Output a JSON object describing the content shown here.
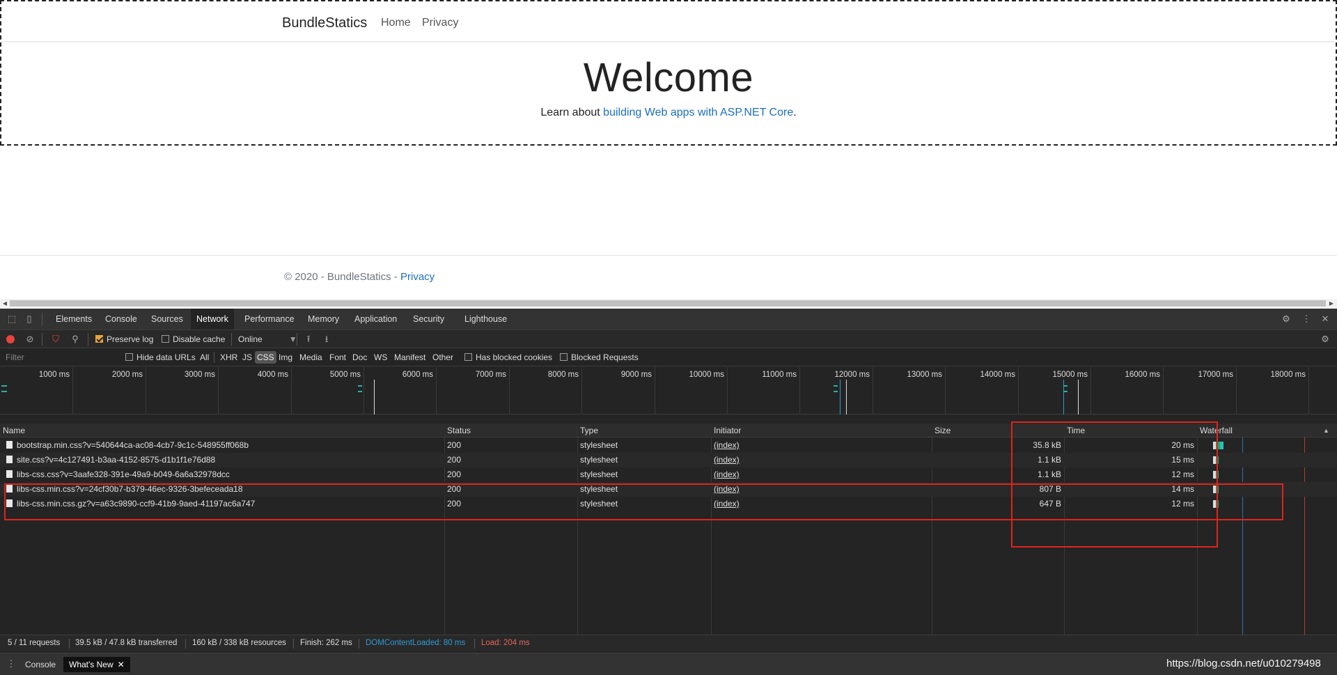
{
  "site": {
    "brand": "BundleStatics",
    "nav": [
      "Home",
      "Privacy"
    ],
    "hero_title": "Welcome",
    "hero_text": "Learn about ",
    "hero_link": "building Web apps with ASP.NET Core",
    "hero_end": ".",
    "footer_text": "© 2020 - BundleStatics - ",
    "footer_link": "Privacy"
  },
  "devtools": {
    "tabs": [
      "Elements",
      "Console",
      "Sources",
      "Network",
      "Performance",
      "Memory",
      "Application",
      "Security",
      "Lighthouse"
    ],
    "active_tab": "Network",
    "toolbar": {
      "preserve_log": "Preserve log",
      "disable_cache": "Disable cache",
      "throttle": "Online"
    },
    "filter": {
      "placeholder": "Filter",
      "hide_data_urls": "Hide data URLs",
      "types": [
        "All",
        "XHR",
        "JS",
        "CSS",
        "Img",
        "Media",
        "Font",
        "Doc",
        "WS",
        "Manifest",
        "Other"
      ],
      "active_type": "CSS",
      "blocked_cookies": "Has blocked cookies",
      "blocked_requests": "Blocked Requests"
    },
    "overview_ticks": [
      "1000 ms",
      "2000 ms",
      "3000 ms",
      "4000 ms",
      "5000 ms",
      "6000 ms",
      "7000 ms",
      "8000 ms",
      "9000 ms",
      "10000 ms",
      "11000 ms",
      "12000 ms",
      "13000 ms",
      "14000 ms",
      "15000 ms",
      "16000 ms",
      "17000 ms",
      "18000 ms"
    ],
    "columns": [
      "Name",
      "Status",
      "Type",
      "Initiator",
      "Size",
      "Time",
      "Waterfall"
    ],
    "requests": [
      {
        "name": "bootstrap.min.css?v=540644ca-ac08-4cb7-9c1c-548955ff068b",
        "status": "200",
        "type": "stylesheet",
        "initiator": "(index)",
        "size": "35.8 kB",
        "time": "20 ms"
      },
      {
        "name": "site.css?v=4c127491-b3aa-4152-8575-d1b1f1e76d88",
        "status": "200",
        "type": "stylesheet",
        "initiator": "(index)",
        "size": "1.1 kB",
        "time": "15 ms"
      },
      {
        "name": "libs-css.css?v=3aafe328-391e-49a9-b049-6a6a32978dcc",
        "status": "200",
        "type": "stylesheet",
        "initiator": "(index)",
        "size": "1.1 kB",
        "time": "12 ms"
      },
      {
        "name": "libs-css.min.css?v=24cf30b7-b379-46ec-9326-3befeceada18",
        "status": "200",
        "type": "stylesheet",
        "initiator": "(index)",
        "size": "807 B",
        "time": "14 ms"
      },
      {
        "name": "libs-css.min.css.gz?v=a63c9890-ccf9-41b9-9aed-41197ac6a747",
        "status": "200",
        "type": "stylesheet",
        "initiator": "(index)",
        "size": "647 B",
        "time": "12 ms"
      }
    ],
    "status_bar": {
      "requests": "5 / 11 requests",
      "transferred": "39.5 kB / 47.8 kB transferred",
      "resources": "160 kB / 338 kB resources",
      "finish": "Finish: 262 ms",
      "dcl": "DOMContentLoaded: 80 ms",
      "load": "Load: 204 ms"
    },
    "drawer_tabs": [
      "Console",
      "What's New"
    ],
    "colors": {
      "dcl": "#2f9bd5",
      "load": "#e2665a",
      "accent": "#e0241b"
    }
  },
  "watermark": "https://blog.csdn.net/u010279498"
}
